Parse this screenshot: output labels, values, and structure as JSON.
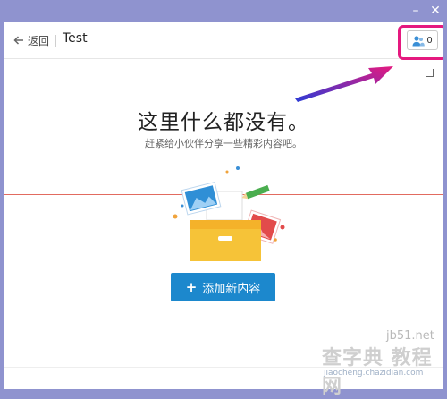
{
  "window": {
    "minimize_glyph": "–",
    "close_glyph": "✕"
  },
  "header": {
    "back_label": "返回",
    "title": "Test",
    "members_count": "0"
  },
  "empty_state": {
    "title": "这里什么都没有。",
    "subtitle": "赶紧给小伙伴分享一些精彩内容吧。"
  },
  "add_button": {
    "plus": "+",
    "label": "添加新内容"
  },
  "watermark": {
    "url": "jb51.net",
    "main": "查字典 教程网",
    "sub": "jiaocheng.chazidian.com"
  },
  "colors": {
    "titlebar": "#8f93cf",
    "accent_button": "#1c88cd",
    "highlight_box": "#e5197f",
    "guide_line": "#e26b60"
  },
  "icons": [
    "back-arrow-icon",
    "members-icon",
    "box-illustration",
    "annotation-arrow"
  ]
}
